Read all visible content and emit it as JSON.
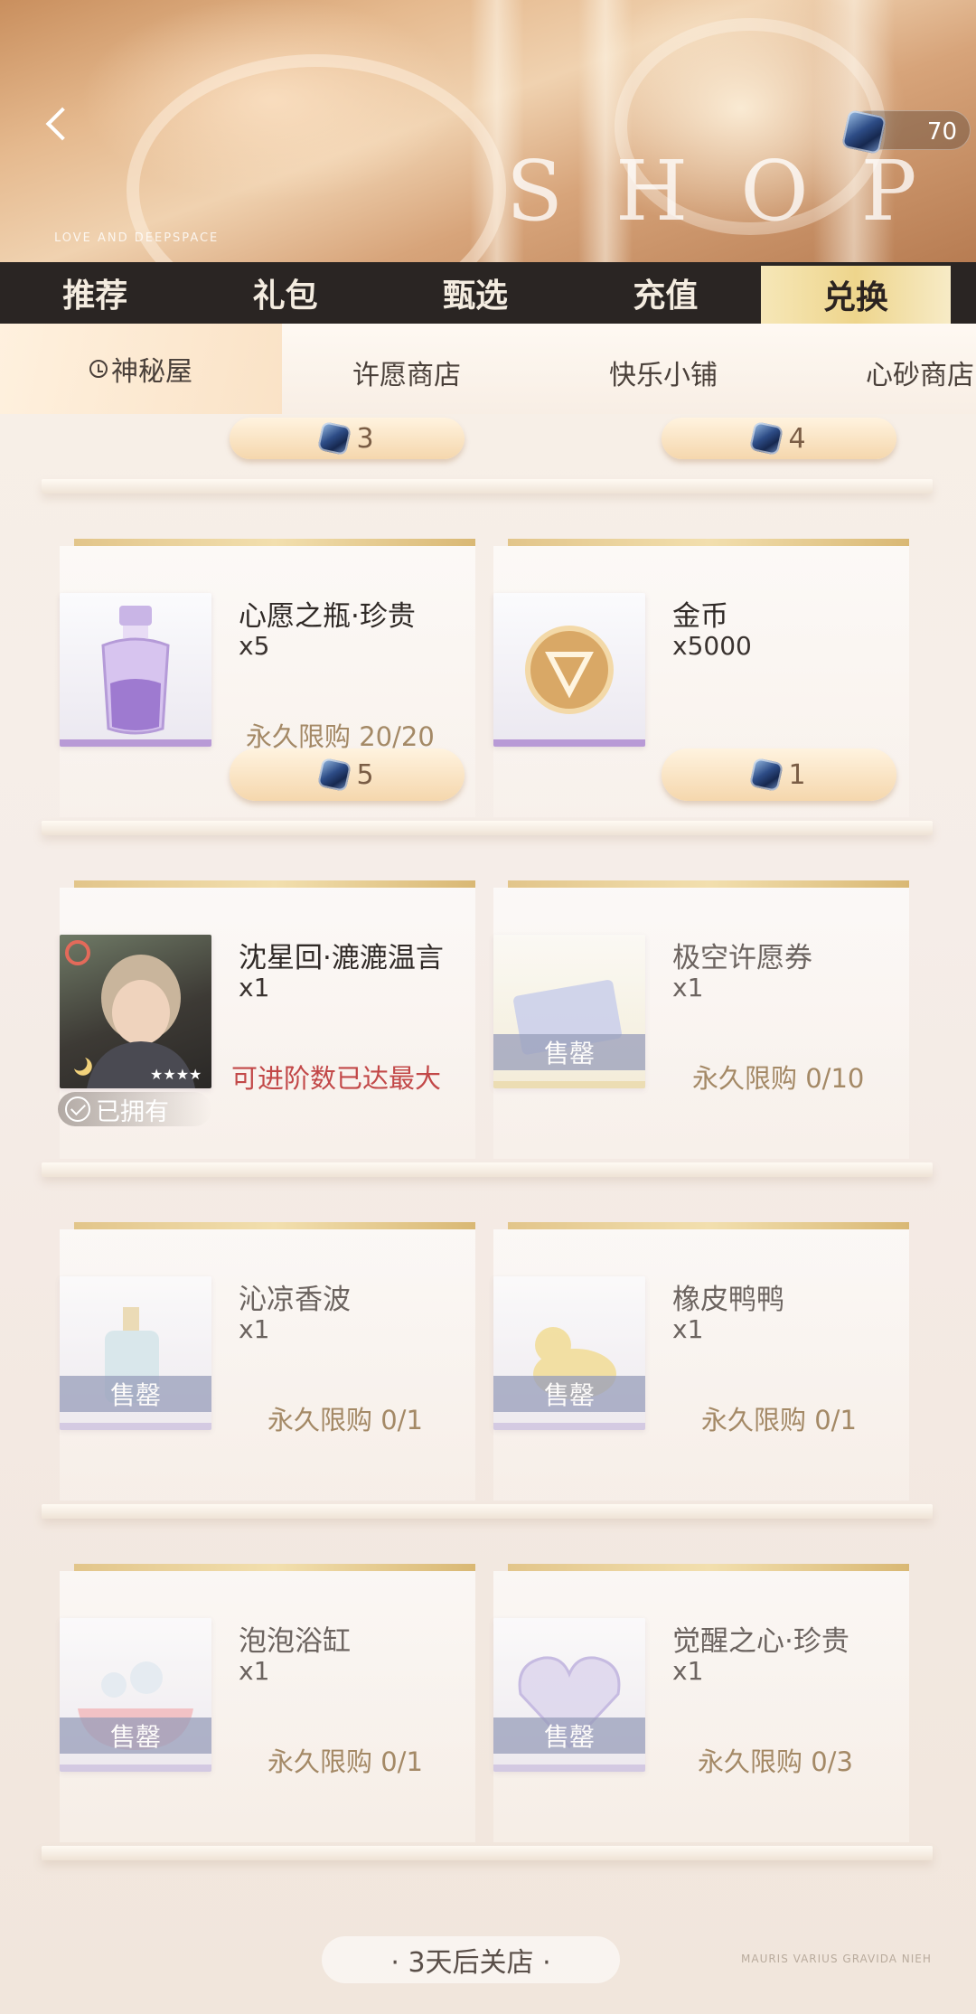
{
  "header": {
    "currency_value": "70",
    "shop_title": "SHOP",
    "brand_text": "LOVE AND DEEPSPACE"
  },
  "main_tabs": [
    {
      "label": "推荐"
    },
    {
      "label": "礼包"
    },
    {
      "label": "甄选"
    },
    {
      "label": "充值"
    },
    {
      "label": "兑换",
      "active": true
    }
  ],
  "sub_tabs": [
    {
      "label": "神秘屋",
      "active": true
    },
    {
      "label": "许愿商店"
    },
    {
      "label": "快乐小铺"
    },
    {
      "label": "心砂商店"
    }
  ],
  "prev_row_prices": [
    "3",
    "4"
  ],
  "items": [
    {
      "name": "心愿之瓶·珍贵",
      "qty": "x5",
      "status": "永久限购 20/20",
      "price": "5"
    },
    {
      "name": "金币",
      "qty": "x5000",
      "price": "1"
    },
    {
      "name": "沈星回·漉漉温言",
      "qty": "x1",
      "status": "可进阶数已达最大",
      "owned_label": "已拥有"
    },
    {
      "name": "极空许愿券",
      "qty": "x1",
      "status": "永久限购 0/10",
      "sold_label": "售罄"
    },
    {
      "name": "沁凉香波",
      "qty": "x1",
      "status": "永久限购 0/1",
      "sold_label": "售罄"
    },
    {
      "name": "橡皮鸭鸭",
      "qty": "x1",
      "status": "永久限购 0/1",
      "sold_label": "售罄"
    },
    {
      "name": "泡泡浴缸",
      "qty": "x1",
      "status": "永久限购 0/1",
      "sold_label": "售罄"
    },
    {
      "name": "觉醒之心·珍贵",
      "qty": "x1",
      "status": "永久限购 0/3",
      "sold_label": "售罄"
    }
  ],
  "footer": {
    "close_notice": "· 3天后关店 ·",
    "tagline": "MAURIS VARIUS GRAVIDA NIEH"
  },
  "colors": {
    "accent_gold": "#eed58c",
    "tabbar_bg": "#2a2523",
    "limit_red": "#c24848"
  }
}
